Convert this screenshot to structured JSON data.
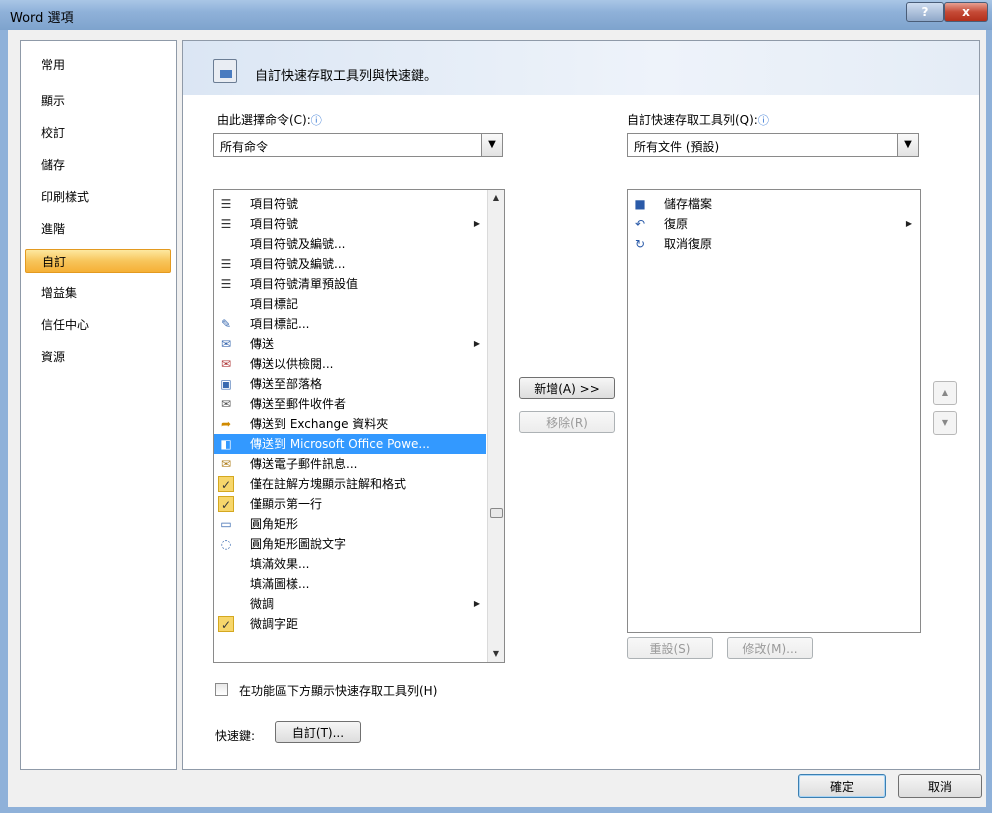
{
  "window": {
    "title": "Word 選項",
    "help_label": "?",
    "close_label": "x"
  },
  "nav": {
    "items": [
      "常用",
      "顯示",
      "校訂",
      "儲存",
      "印刷樣式",
      "進階",
      "自訂",
      "增益集",
      "信任中心",
      "資源"
    ],
    "active_index": 6
  },
  "banner": {
    "text": "自訂快速存取工具列與快速鍵。"
  },
  "left": {
    "label": "由此選擇命令(C):",
    "combo_value": "所有命令",
    "commands": [
      {
        "icon": "list-bullets-icon",
        "label": "項目符號",
        "submenu": false
      },
      {
        "icon": "list-bullets-icon",
        "label": "項目符號",
        "submenu": true
      },
      {
        "icon": "",
        "label": "項目符號及編號...",
        "submenu": false
      },
      {
        "icon": "list-bullets-icon",
        "label": "項目符號及編號...",
        "submenu": false
      },
      {
        "icon": "list-bullets-icon",
        "label": "項目符號清單預設值",
        "submenu": false
      },
      {
        "icon": "",
        "label": "項目標記",
        "submenu": false
      },
      {
        "icon": "mark-entry-icon",
        "label": "項目標記...",
        "submenu": false
      },
      {
        "icon": "send-icon",
        "label": "傳送",
        "submenu": true
      },
      {
        "icon": "send-review-icon",
        "label": "傳送以供檢閱...",
        "submenu": false
      },
      {
        "icon": "blog-icon",
        "label": "傳送至部落格",
        "submenu": false
      },
      {
        "icon": "mail-recipient-icon",
        "label": "傳送至郵件收件者",
        "submenu": false
      },
      {
        "icon": "exchange-folder-icon",
        "label": "傳送到 Exchange 資料夾",
        "submenu": false
      },
      {
        "icon": "powerpoint-icon",
        "label": "傳送到 Microsoft Office Powe...",
        "submenu": false
      },
      {
        "icon": "email-message-icon",
        "label": "傳送電子郵件訊息...",
        "submenu": false
      },
      {
        "icon": "checkmark-icon",
        "label": "僅在註解方塊顯示註解和格式",
        "submenu": false
      },
      {
        "icon": "checkmark-icon",
        "label": "僅顯示第一行",
        "submenu": false
      },
      {
        "icon": "rounded-rect-icon",
        "label": "圓角矩形",
        "submenu": false
      },
      {
        "icon": "rounded-callout-icon",
        "label": "圓角矩形圖說文字",
        "submenu": false
      },
      {
        "icon": "",
        "label": "填滿效果...",
        "submenu": false
      },
      {
        "icon": "",
        "label": "填滿圖樣...",
        "submenu": false
      },
      {
        "icon": "",
        "label": "微調",
        "submenu": true
      },
      {
        "icon": "checkmark-icon",
        "label": "微調字距",
        "submenu": false
      }
    ],
    "selected_index": 12
  },
  "right": {
    "label": "自訂快速存取工具列(Q):",
    "combo_value": "所有文件 (預設)",
    "items": [
      {
        "icon": "save-icon",
        "label": "儲存檔案",
        "submenu": false
      },
      {
        "icon": "undo-icon",
        "label": "復原",
        "submenu": true
      },
      {
        "icon": "redo-icon",
        "label": "取消復原",
        "submenu": false
      }
    ]
  },
  "buttons": {
    "add": "新增(A) >>",
    "remove": "移除(R)",
    "reset": "重設(S)",
    "modify": "修改(M)...",
    "move_up": "▲",
    "move_down": "▼",
    "customize": "自訂(T)...",
    "ok": "確定",
    "cancel": "取消"
  },
  "show_below_ribbon": {
    "label": "在功能區下方顯示快速存取工具列(H)",
    "checked": false
  },
  "shortcut_label": "快速鍵:",
  "colors": {
    "selection": "#3399ff",
    "nav_active": "#f7c55b"
  }
}
